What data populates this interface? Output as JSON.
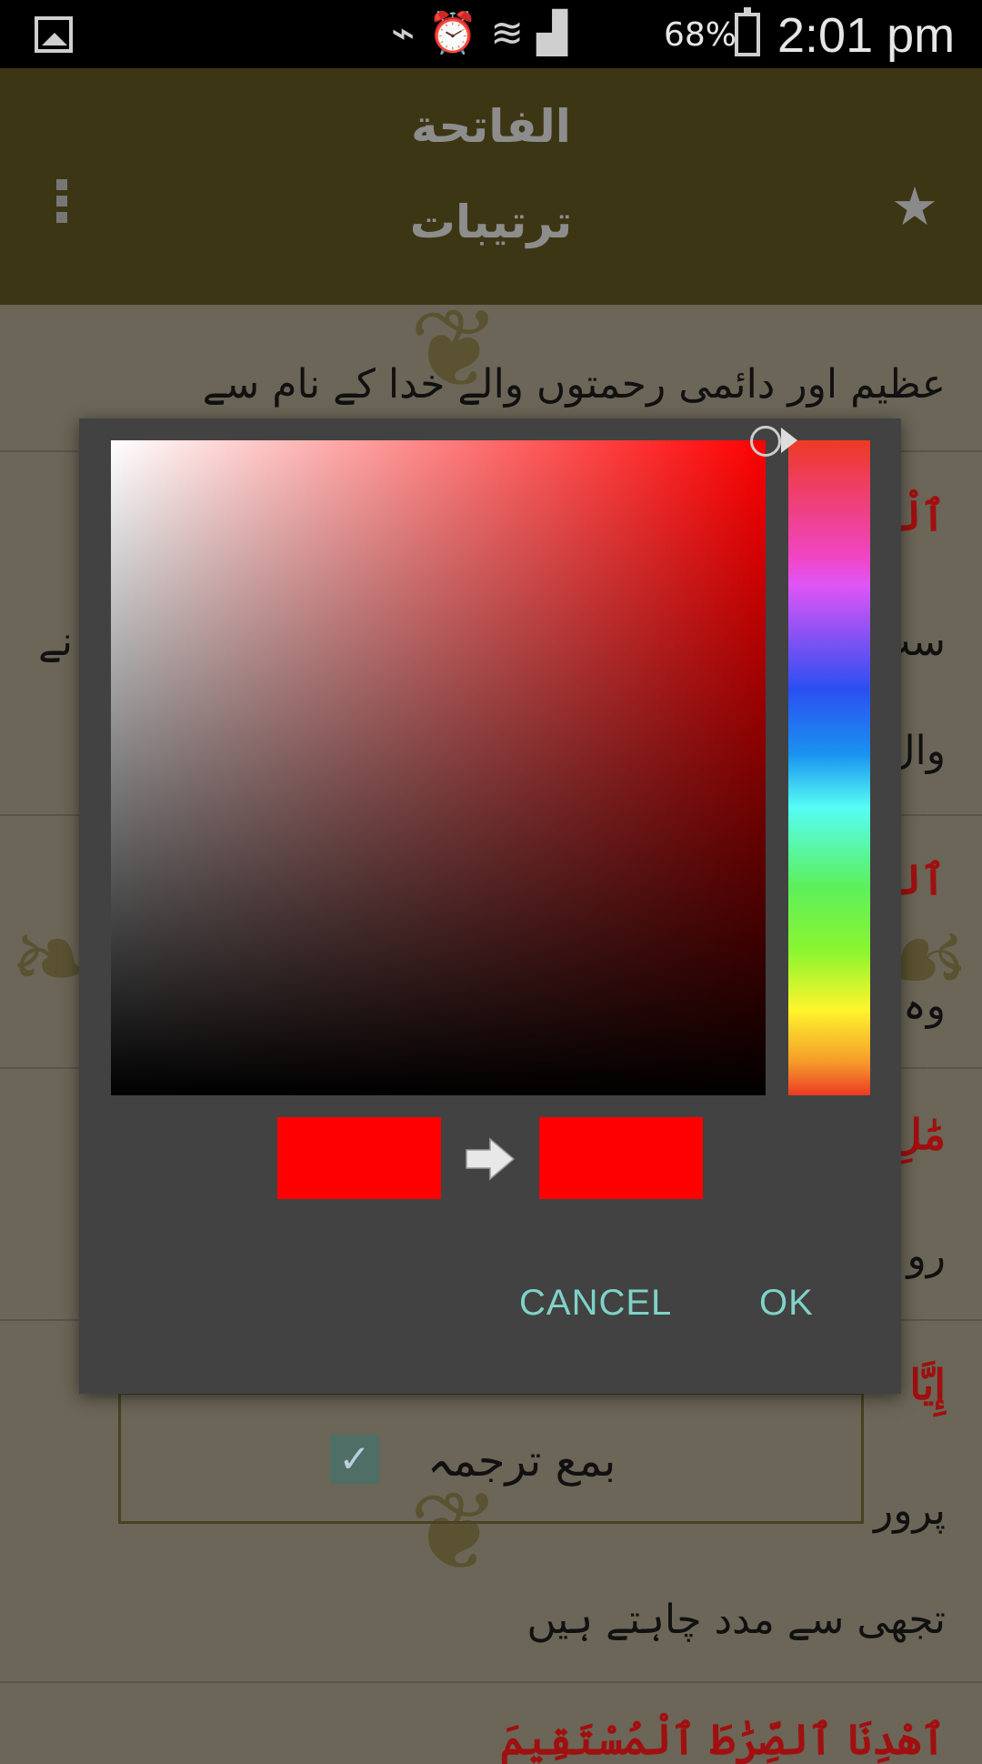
{
  "status_bar": {
    "icons": [
      "gallery-icon",
      "vibrate-icon",
      "alarm-icon",
      "wifi-icon",
      "signal-icon",
      "battery-icon"
    ],
    "battery": "68%",
    "time": "2:01 pm"
  },
  "app_bar": {
    "title": "الفاتحة",
    "subtitle": "ترتیبات",
    "icons": [
      "overflow-menu-icon",
      "star-icon"
    ]
  },
  "background": {
    "verse_fragment_1": "ٱلْحَ",
    "line_1": "عظیم اور دائمی رحمتوں والے خدا کے نام سے",
    "line_2": "سب",
    "line_2b": "نے",
    "line_3": "وال",
    "verse_fragment_2": "ٱلرَّ",
    "line_4": "وہ",
    "verse_fragment_3": "مَٰلِ",
    "line_5": "رو",
    "verse_fragment_4": "إِيَّا",
    "line_6": "پرور",
    "line_7": "تجھی سے مدد چاہتے ہیں",
    "verse_fragment_5": "ٱهْدِنَا ٱلصِّرَٰطَ ٱلْمُسْتَقِيمَ",
    "checkbox_label": "بمع ترجمہ",
    "checkbox_checked": true
  },
  "color_picker": {
    "current_hue_color": "#ff0000",
    "old_color": "#ff0000",
    "new_color": "#ff0000",
    "cancel_label": "CANCEL",
    "ok_label": "OK"
  },
  "colors": {
    "app_bar": "#3d3614",
    "dialog": "#424242",
    "accent_button": "#7fd3c8",
    "verse_red": "#a01010"
  }
}
